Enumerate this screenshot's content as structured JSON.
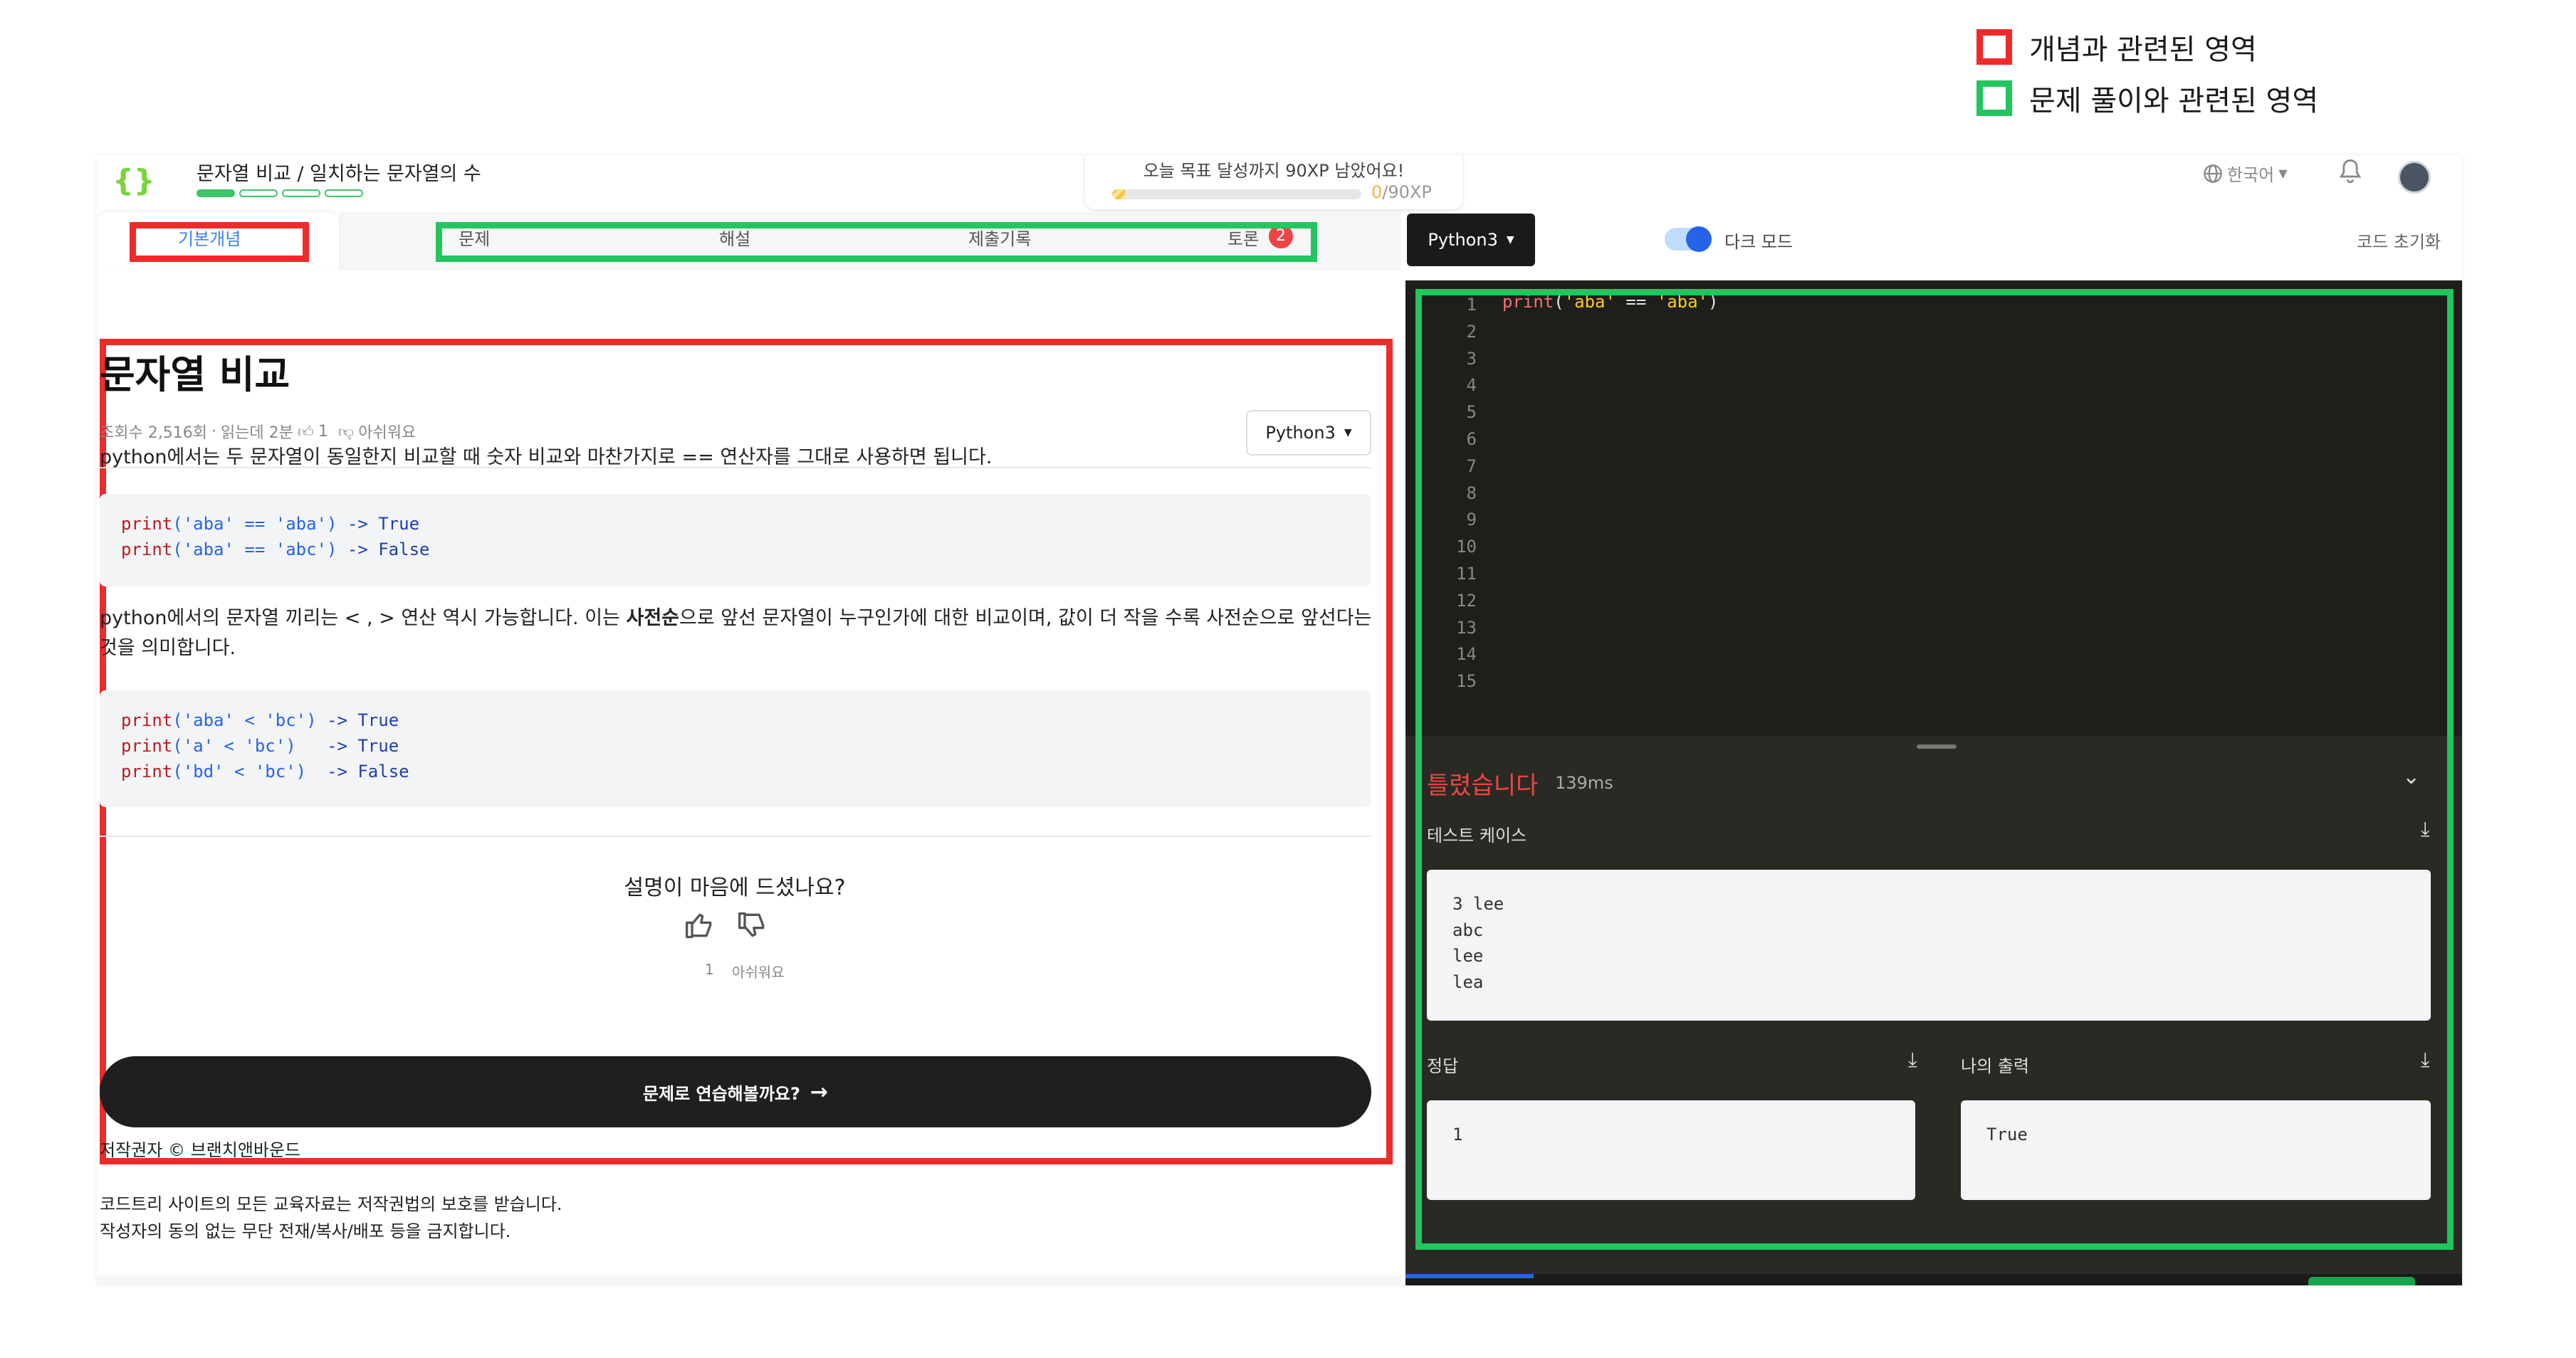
{
  "legend": [
    {
      "label": "개념과 관련된 영역",
      "color": "#ef2a2a"
    },
    {
      "label": "문제 풀이와 관련된 영역",
      "color": "#22c55e"
    }
  ],
  "header": {
    "breadcrumb": "문자열 비교 / 일치하는 문자열의 수",
    "progress": {
      "filled": 1,
      "total": 4
    },
    "goal_text": "오늘 목표 달성까지 90XP 남았어요!",
    "goal_progress": "0/90XP",
    "goal_fraction": 0.05,
    "language": "한국어"
  },
  "tabs": [
    {
      "label": "기본개념",
      "active": true
    },
    {
      "label": "문제"
    },
    {
      "label": "해설"
    },
    {
      "label": "제출기록"
    },
    {
      "label": "토론",
      "badge": "2"
    }
  ],
  "concept": {
    "title": "문자열 비교",
    "meta": {
      "views": "조회수 2,516회",
      "read_time": "읽는데 2분",
      "likes": "1",
      "dislike_label": "아쉬워요"
    },
    "lang_select": "Python3",
    "para1": "python에서는 두 문자열이 동일한지 비교할 때 숫자 비교와 마찬가지로  ==  연산자를 그대로 사용하면 됩니다.",
    "code1": [
      {
        "fn": "print",
        "args": "('aba' == 'aba')",
        "result": " -> True"
      },
      {
        "fn": "print",
        "args": "('aba' == 'abc')",
        "result": " -> False"
      }
    ],
    "para2_a": "python에서의 문자열 끼리는  < ,  >  연산 역시 가능합니다. 이는 ",
    "para2_bold": "사전순",
    "para2_b": "으로 앞선 문자열이 누구인가에 대한 비교이며, 값이 더 작을 수록 사전순으로 앞선다는 것을 의미합니다.",
    "code2": [
      {
        "fn": "print",
        "args": "('aba' < 'bc')",
        "result": " -> True"
      },
      {
        "fn": "print",
        "args": "('a' < 'bc')  ",
        "result": " -> True"
      },
      {
        "fn": "print",
        "args": "('bd' < 'bc') ",
        "result": " -> False"
      }
    ],
    "feedback_question": "설명이 마음에 드셨나요?",
    "like_count": "1",
    "dislike_label": "아쉬워요",
    "cta_label": "문제로 연습해볼까요?"
  },
  "footer": {
    "copyright": "저작권자 © 브랜치앤바운드",
    "line1": "코드트리 사이트의 모든 교육자료는 저작권법의 보호를 받습니다.",
    "line2": "작성자의 동의 없는 무단 전재/복사/배포 등을 금지합니다."
  },
  "editor": {
    "language": "Python3",
    "dark_mode_label": "다크 모드",
    "reset_label": "코드 초기화",
    "line_numbers": [
      "1",
      "2",
      "3",
      "4",
      "5",
      "6",
      "7",
      "8",
      "9",
      "10",
      "11",
      "12",
      "13",
      "14",
      "15"
    ],
    "code_fn": "print",
    "code_open": "(",
    "code_str1": "'aba'",
    "code_op": " == ",
    "code_str2": "'aba'",
    "code_close": ")"
  },
  "result": {
    "status": "틀렸습니다",
    "time": "139ms",
    "testcase_label": "테스트 케이스",
    "testcase": "3 lee\nabc\nlee\nlea",
    "answer_label": "정답",
    "answer": "1",
    "output_label": "나의 출력",
    "output": "True"
  }
}
